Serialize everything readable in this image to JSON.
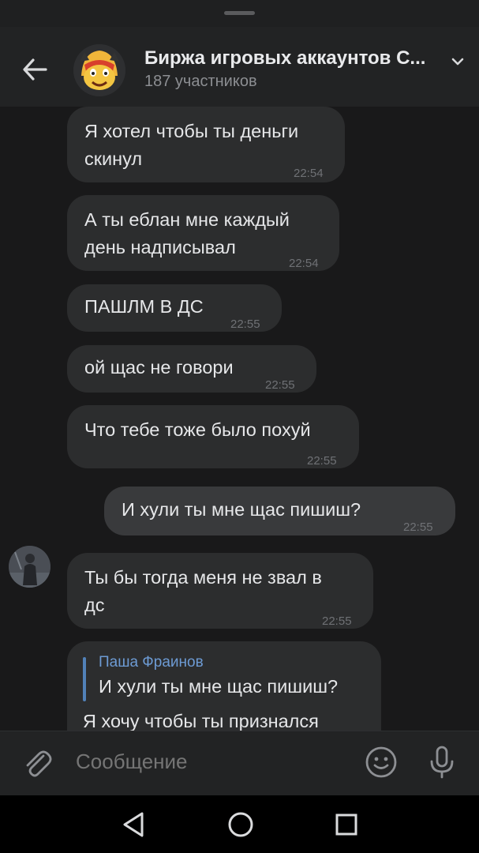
{
  "header": {
    "title": "Биржа игровых аккаунтов C...",
    "subtitle": "187 участников",
    "back_icon": "arrow-left-icon",
    "expand_icon": "chevron-down-icon"
  },
  "messages": [
    {
      "direction": "in",
      "lines": [
        "Я хотел чтобы ты деньги",
        "скинул"
      ],
      "time": "22:54"
    },
    {
      "direction": "in",
      "lines": [
        "А ты еблан мне каждый",
        "день надписывал"
      ],
      "time": "22:54"
    },
    {
      "direction": "in",
      "lines": [
        "ПАШЛМ В ДС"
      ],
      "time": "22:55"
    },
    {
      "direction": "in",
      "lines": [
        "ой щас не говори"
      ],
      "time": "22:55"
    },
    {
      "direction": "in",
      "lines": [
        "Что тебе тоже было похуй"
      ],
      "time": "22:55"
    },
    {
      "direction": "out",
      "lines": [
        "И хули ты мне щас пишиш?"
      ],
      "time": "22:55"
    },
    {
      "direction": "in",
      "lines": [
        "Ты бы тогда меня не звал в",
        "дс"
      ],
      "time": "22:55"
    }
  ],
  "reply_message": {
    "quoted_author": "Паша Фраинов",
    "quoted_text": "И хули ты мне щас пишиш?",
    "text": "Я хочу чтобы ты признался"
  },
  "composer": {
    "placeholder": "Сообщение",
    "attach_icon": "paperclip-icon",
    "emoji_icon": "smiley-icon",
    "mic_icon": "microphone-icon"
  },
  "navbar": {
    "icons": [
      "nav-back-icon",
      "nav-home-icon",
      "nav-recent-icon"
    ]
  },
  "colors": {
    "background": "#19191a",
    "header": "#222324",
    "bubble_in": "#2c2d2e",
    "bubble_out": "#393a3c",
    "link": "#6d9bd4"
  }
}
